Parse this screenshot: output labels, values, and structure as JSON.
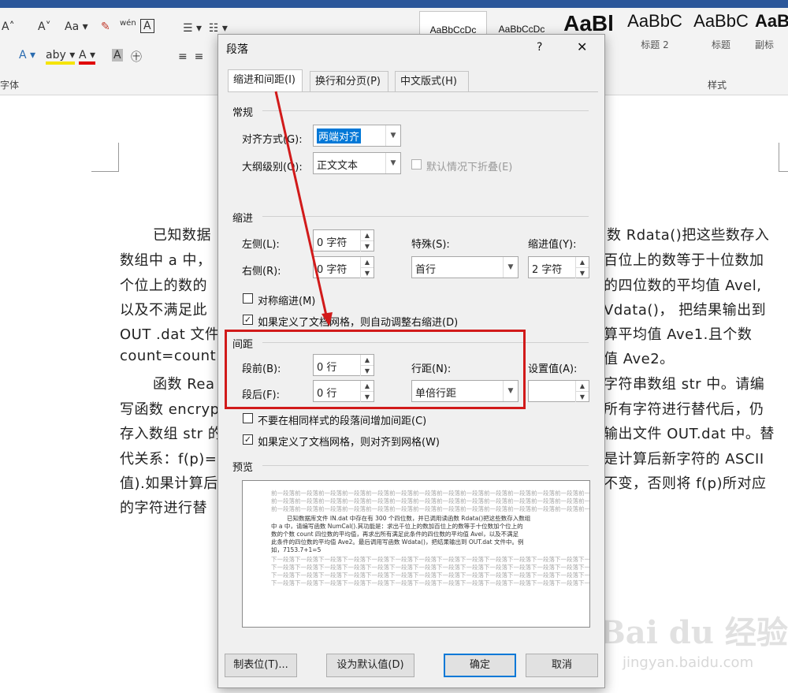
{
  "ribbon": {
    "font_group_label": "字体",
    "styles_group_label": "样式",
    "style_samples": [
      {
        "sample": "AaBbCcDc",
        "name": ""
      },
      {
        "sample": "AaBbCcDc",
        "name": ""
      },
      {
        "sample": "AaBl",
        "name": ""
      },
      {
        "sample": "AaBbC",
        "name": "标题 2"
      },
      {
        "sample": "AaBbC",
        "name": "标题"
      },
      {
        "sample": "AaB",
        "name": "副标"
      }
    ],
    "font_buttons": [
      "A˄",
      "A˅",
      "Aa ▾",
      "✎",
      "wén",
      "A"
    ],
    "color_buttons": [
      "A ▾",
      "aby ▾",
      "A ▾",
      "A",
      "㊉"
    ]
  },
  "document": {
    "lines": [
      "已知数据",
      "数组中 a 中，",
      "个位上的数的",
      "以及不满足此",
      "OUT .dat  文件",
      "count=count+",
      "函数 Rea",
      "写函数 encryp",
      "存入数组 str 的",
      "代关系：f(p)=p",
      "值).如果计算后",
      "的字符进行替"
    ],
    "right_lines": [
      "数 Rdata()把这些数存入",
      "百位上的数等于十位数加",
      "的四位数的平均值 Avel,",
      "Vdata()，  把结果输出到",
      "算平均值  Ave1.且个数",
      "值 Ave2。",
      "字符串数组 str 中。请编",
      "所有字符进行替代后，仍",
      "输出文件 OUT.dat 中。替",
      "是计算后新字符的 ASCII",
      "不变，否则将 f(p)所对应"
    ]
  },
  "dialog": {
    "title": "段落",
    "help": "?",
    "close": "✕",
    "tabs": [
      "缩进和间距(I)",
      "换行和分页(P)",
      "中文版式(H)"
    ],
    "general": {
      "section": "常规",
      "alignment_label": "对齐方式(G):",
      "alignment_value": "两端对齐",
      "outline_label": "大纲级别(O):",
      "outline_value": "正文文本",
      "collapse_label": "默认情况下折叠(E)"
    },
    "indent": {
      "section": "缩进",
      "left_label": "左侧(L):",
      "left_value": "0 字符",
      "right_label": "右侧(R):",
      "right_value": "0 字符",
      "special_label": "特殊(S):",
      "special_value": "首行",
      "indent_by_label": "缩进值(Y):",
      "indent_by_value": "2 字符",
      "mirror_label": "对称缩进(M)",
      "auto_adjust_label": "如果定义了文档网格，则自动调整右缩进(D)"
    },
    "spacing": {
      "section": "间距",
      "before_label": "段前(B):",
      "before_value": "0 行",
      "after_label": "段后(F):",
      "after_value": "0 行",
      "line_spacing_label": "行距(N):",
      "line_spacing_value": "单倍行距",
      "at_label": "设置值(A):",
      "at_value": "",
      "no_space_label": "不要在相同样式的段落间增加间距(C)",
      "snap_grid_label": "如果定义了文档网格，则对齐到网格(W)"
    },
    "preview": {
      "section": "预览",
      "prev_text": "前一段落前一段落前一段落前一段落前一段落前一段落前一段落前一段落前一段落前一段落前一段落前一段落前一段落前一段落前一段落前一段落前一段落前一段落前一段落前一段落前一段落前一段落前一段落前一段落",
      "body_lines": [
        "已知数据库文件 IN.dat 中存在有 300 个四位数，并已调用读函数 Rdata()把这些数存入数组",
        "中 a 中，请编写函数 NumCal().其功能是：求出千位上的数加百位上的数等于十位数加个位上的",
        "数的个数 count 四位数的平均值，再求出所有满足此条件的四位数的平均值 Avel，以及不满足",
        "此条件的四位数的平均值 Ave2。最后调用写函数 Wdata()，把结果输出到 OUT.dat 文件中。例",
        "如，7153.7+1=5"
      ],
      "next_text": "下一段落下一段落下一段落下一段落下一段落下一段落下一段落下一段落下一段落下一段落下一段落下一段落下一段落下一段落下一段落下一段落下一段落下一段落下一段落下一段落下一段落下一段落下一段落下一段落下一段落"
    },
    "buttons": {
      "tabs": "制表位(T)...",
      "set_default": "设为默认值(D)",
      "ok": "确定",
      "cancel": "取消"
    }
  },
  "watermark": {
    "main": "Bai du 经验",
    "sub": "jingyan.baidu.com"
  },
  "colors": {
    "highlight": "#d11a1a",
    "selection": "#0078d7",
    "title_bar": "#2b579a"
  }
}
